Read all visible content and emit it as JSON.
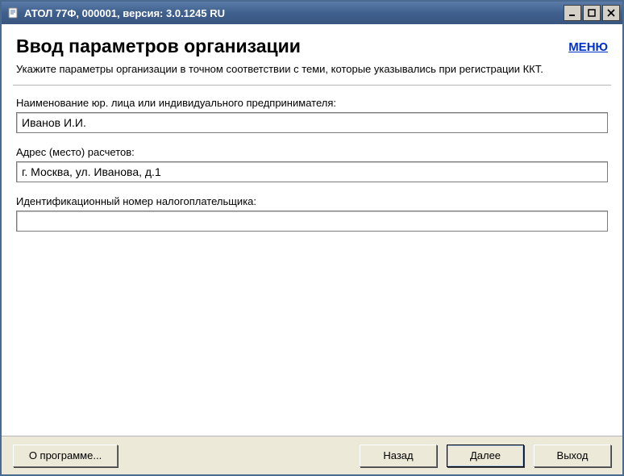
{
  "window": {
    "title": "АТОЛ 77Ф, 000001, версия: 3.0.1245 RU"
  },
  "header": {
    "title": "Ввод параметров организации",
    "menu_label": "МЕНЮ",
    "subtitle": "Укажите параметры организации в точном соответствии с теми, которые указывались при регистрации ККТ."
  },
  "fields": {
    "org_name": {
      "label": "Наименование юр. лица или индивидуального предпринимателя:",
      "value": "Иванов И.И."
    },
    "address": {
      "label": "Адрес (место) расчетов:",
      "value": "г. Москва, ул. Иванова, д.1"
    },
    "inn": {
      "label": "Идентификационный номер налогоплательщика:",
      "value": ""
    }
  },
  "buttons": {
    "about": "О программе...",
    "back": "Назад",
    "next": "Далее",
    "exit": "Выход"
  }
}
